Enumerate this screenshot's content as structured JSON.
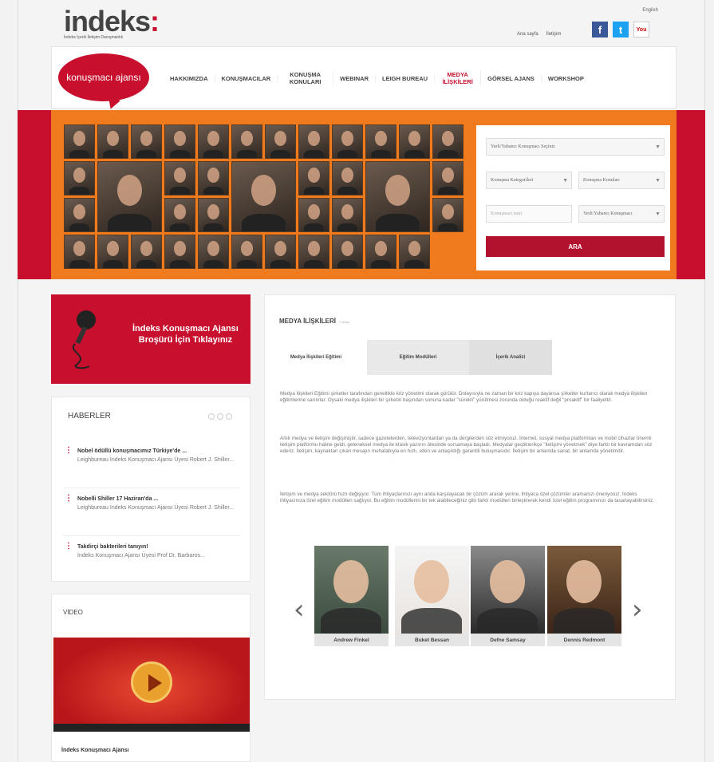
{
  "header": {
    "logo_word": "indeks",
    "logo_colon": ":",
    "logo_tagline": "İndeks İçerik İletişim Danışmanlık",
    "language_link": "English",
    "links": [
      "Ana sayfa",
      "İletişim"
    ],
    "social": [
      "facebook-icon",
      "twitter-icon",
      "youtube-icon"
    ],
    "social_labels": {
      "facebook": "f",
      "twitter": "t",
      "youtube": "You"
    }
  },
  "nav": {
    "brand": "konuşmacı ajansı",
    "items": [
      "HAKKIMIZDA",
      "KONUŞMACILAR",
      "KONUŞMA KONULARI",
      "WEBINAR",
      "LEIGH BUREAU",
      "MEDYA İLİŞKİLERİ",
      "GÖRSEL AJANS",
      "WORKSHOP"
    ],
    "active": "MEDYA İLİŞKİLERİ"
  },
  "search": {
    "field1": "Yerli/Yabancı Konuşmacı Seçiniz",
    "field2": "Konuşma Kategorileri",
    "field3": "Konuşma Konuları",
    "field4_placeholder": "Konuşmacı ismi",
    "field5": "Yerli/Yabancı Konuşmacı",
    "button": "ARA"
  },
  "brochure": {
    "line1": "İndeks Konuşmacı Ajansı",
    "line2": "Broşürü İçin Tıklayınız"
  },
  "news": {
    "title": "HABERLER",
    "items": [
      {
        "title": "Nobel ödüllü konuşmacımız Türkiye'de ...",
        "desc": "Leighbureau İndeks Konuşmacı Ajansı Üyesi Robert J. Shiller..."
      },
      {
        "title": "Nobelli Shiller 17 Haziran'da ...",
        "desc": "Leighbureau İndeks Konuşmacı Ajansı Üyesi Robert J. Shiller..."
      },
      {
        "title": "Takdirçi bakterileri tanıyın!",
        "desc": "İndeks Konuşmacı Ajansı Üyesi Prof Dr. Barbaros..."
      }
    ]
  },
  "video": {
    "title": "VİDEO",
    "caption": "İndeks Konuşmacı Ajansı"
  },
  "main": {
    "title": "MEDYA İLİŞKİLERİ",
    "title_small": "» detay",
    "tabs": [
      "Medya İlişkileri Eğitimi",
      "Eğitim Modülleri",
      "İçerik Analizi"
    ],
    "paragraphs": [
      "Medya İlişkileri Eğitimi şirketler tarafından genellikle kriz yönetimi olarak görülür. Dolayısıyla ne zaman bir kriz kapıya dayansa şirketler kurtarıcı olarak medya ilişkileri eğitimlerine sarılırlar. Oysaki medya ilişkileri bir şirketin başından sonuna kadar \"sürekli\" yürütmesi zorunda olduğu reaktif değil \"proaktif\" bir faaliyettir.",
      "Artık medya ve iletişim değişmiştir, sadece gazetelerden, televizyonlardan ya da dergilerden söz etmiyoruz. İnternet, sosyal medya platformları ve mobil cihazlar önemli iletişim platformu haline geldi, geleneksel medya ile klasik yazının ötesinde sorsamaya başladı. Medyalar geçtiklerikçe \"iletişimi yönetmek\" diye farklı bir kavramdan söz ederiz. İletişim, kaynaktan çıkan mesajın muhatabıyla en hızlı, etkin ve anlaşıldığı garantili buluşmasıdır. İletişim bir anlamda sanat, bir anlamda yönetimdir.",
      "İletişim ve medya sektörü hızlı değişiyor. Tüm ihtiyaçlarınızı aynı anda karşılayacak bir çözüm ararak yerine, ihtiyaca özel çözümler aramanızı öneriyoruz. İndeks ihtiyacınıza özel eğitim modülleri sağlıyor. Bu eğitim modüllerini bir tek alabileceğiniz gibi farklı modülleri birleştirerek kendi özel eğitim programınızı da tasarlayabilirsiniz."
    ],
    "speakers": [
      "Andrew Finkel",
      "Buket Bessan",
      "Defne Samsay",
      "Dennis Redmont"
    ],
    "prev_arrow": "‹",
    "next_arrow": "›"
  },
  "colors": {
    "brand_red": "#c8102e",
    "hero_orange": "#f07b1f"
  }
}
